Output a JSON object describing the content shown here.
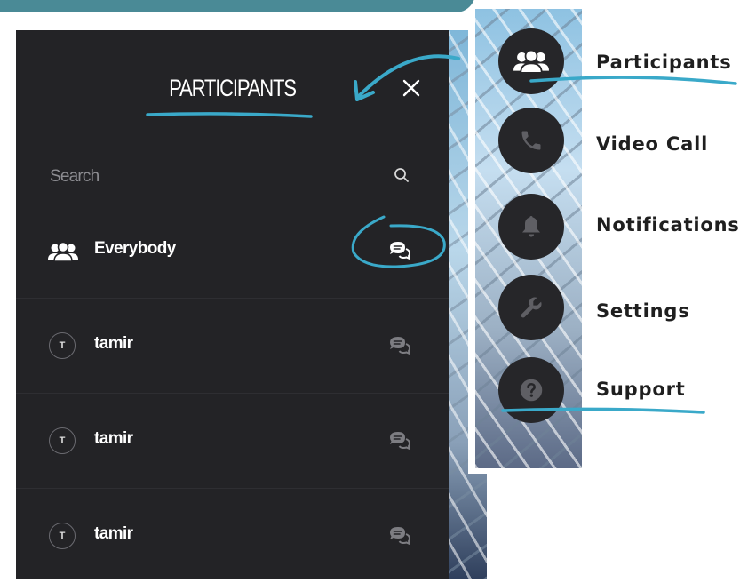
{
  "panel": {
    "title": "PARTICIPANTS",
    "search": {
      "placeholder": "Search",
      "value": ""
    },
    "everybody": {
      "label": "Everybody"
    },
    "participants": [
      {
        "initial": "T",
        "name": "tamir"
      },
      {
        "initial": "T",
        "name": "tamir"
      },
      {
        "initial": "T",
        "name": "tamir"
      }
    ]
  },
  "sidebar": {
    "items": [
      {
        "label": "Participants",
        "icon": "participants-icon"
      },
      {
        "label": "Video Call",
        "icon": "phone-icon"
      },
      {
        "label": "Notifications",
        "icon": "bell-icon"
      },
      {
        "label": "Settings",
        "icon": "wrench-icon"
      },
      {
        "label": "Support",
        "icon": "question-icon"
      }
    ]
  },
  "colors": {
    "panel_bg": "#232326",
    "annotation": "#3aa9c9",
    "top_bar": "#4a8a96"
  }
}
